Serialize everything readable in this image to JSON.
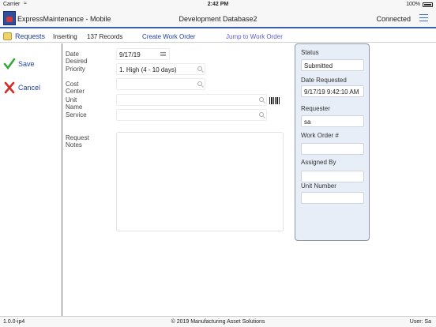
{
  "status_bar": {
    "carrier": "Carrier",
    "time": "2:42 PM",
    "battery": "100%"
  },
  "title_bar": {
    "app_title": "ExpressMaintenance - Mobile",
    "database": "Development Database2",
    "connection": "Connected"
  },
  "toolbar": {
    "section": "Requests",
    "mode": "Inserting",
    "record_count": "137 Records",
    "create_work_order": "Create Work Order",
    "jump_to_work_order": "Jump to Work Order"
  },
  "sidebar": {
    "save_label": "Save",
    "cancel_label": "Cancel"
  },
  "form": {
    "date_desired": {
      "label": "Date Desired",
      "value": "9/17/19"
    },
    "priority": {
      "label": "Priority",
      "value": "1. High (4 - 10 days)"
    },
    "cost_center": {
      "label": "Cost Center",
      "value": ""
    },
    "unit_name": {
      "label": "Unit Name",
      "value": ""
    },
    "service": {
      "label": "Service",
      "value": ""
    },
    "request_notes": {
      "label": "Request Notes",
      "value": ""
    }
  },
  "status_panel": {
    "status": {
      "label": "Status",
      "value": "Submitted"
    },
    "date_requested": {
      "label": "Date Requested",
      "value": "9/17/19 9:42:10 AM"
    },
    "requester": {
      "label": "Requester",
      "value": "sa"
    },
    "work_order": {
      "label": "Work Order #",
      "value": ""
    },
    "assigned_by": {
      "label": "Assigned By",
      "value": ""
    },
    "unit_number": {
      "label": "Unit Number",
      "value": ""
    }
  },
  "footer": {
    "version": "1.0.0-ip4",
    "copyright": "© 2019 Manufacturing Asset Solutions",
    "user": "User: Sa"
  },
  "colors": {
    "accent": "#1f3fa6",
    "link": "#5b5bd6",
    "panel_bg": "#e7eef8",
    "save_green": "#3aa63a",
    "cancel_red": "#d0302a"
  }
}
